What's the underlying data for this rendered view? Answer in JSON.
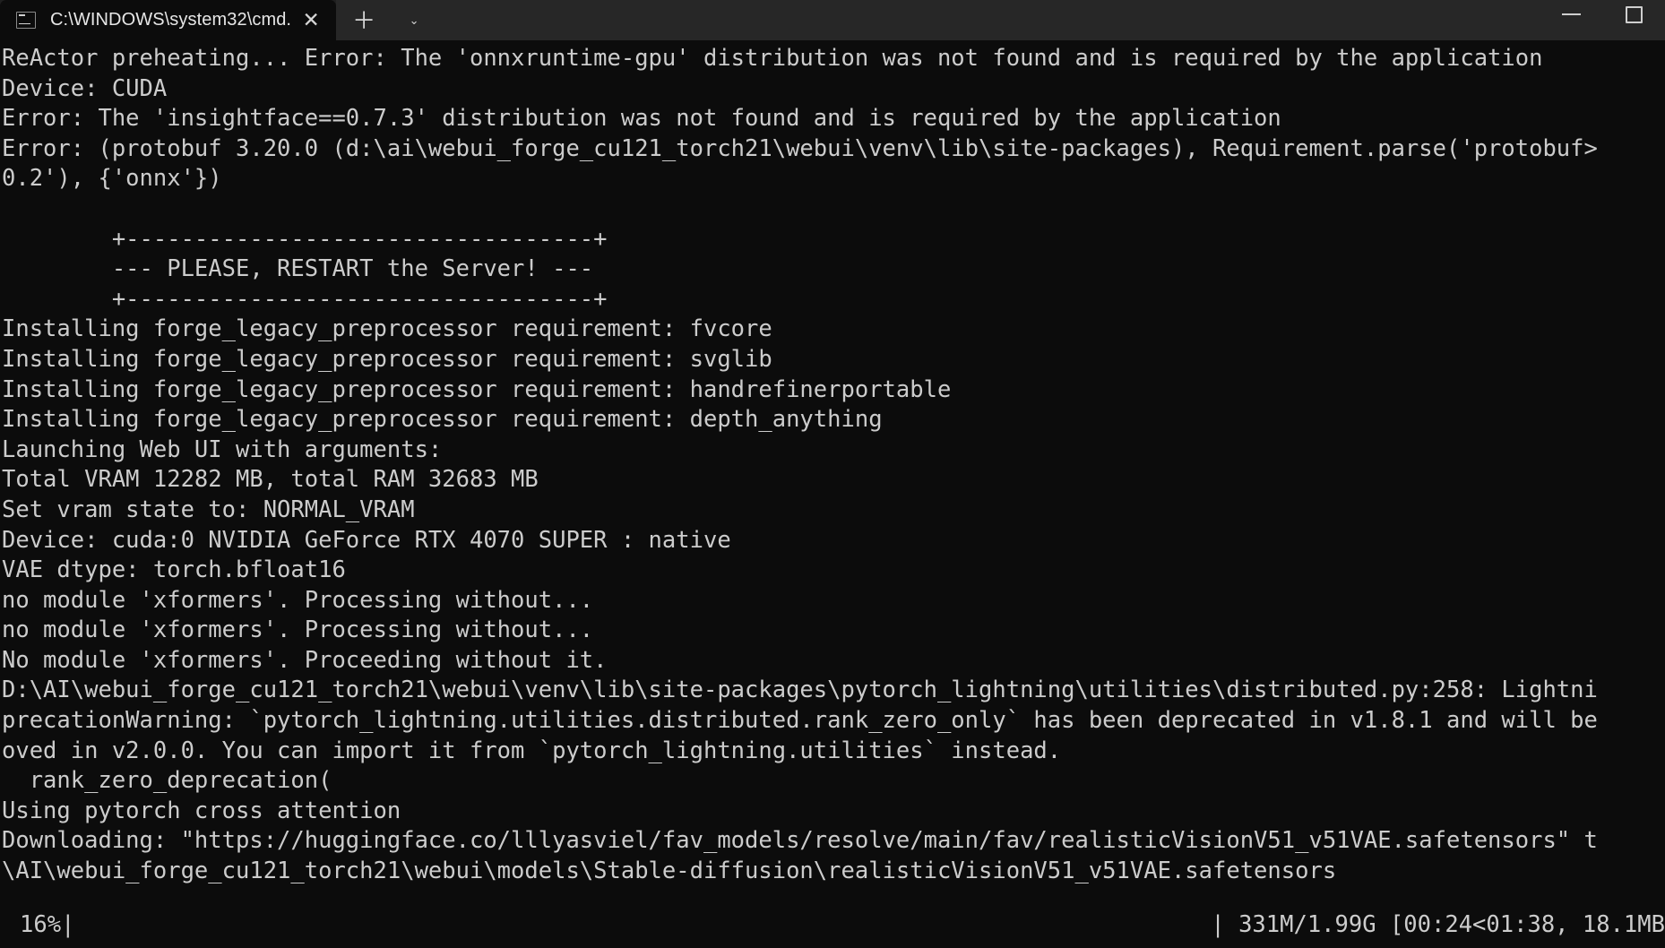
{
  "window": {
    "tab_title": "C:\\WINDOWS\\system32\\cmd.",
    "tab_icon": "cmd-console-icon",
    "close_glyph": "✕",
    "newtab_glyph": "＋",
    "tabmenu_glyph": "⌄",
    "minimize_label": "minimize",
    "maximize_label": "maximize",
    "colors": {
      "chrome_bg": "#272727",
      "tab_bg": "#0c0c0c",
      "terminal_bg": "#0c0c0c",
      "terminal_fg": "#cccccc",
      "progress_fill": "#a6a6a6"
    }
  },
  "console": {
    "lines": [
      "ReActor preheating... Error: The 'onnxruntime-gpu' distribution was not found and is required by the application",
      "Device: CUDA",
      "Error: The 'insightface==0.7.3' distribution was not found and is required by the application",
      "Error: (protobuf 3.20.0 (d:\\ai\\webui_forge_cu121_torch21\\webui\\venv\\lib\\site-packages), Requirement.parse('protobuf>",
      "0.2'), {'onnx'})",
      "",
      "        +----------------------------------+",
      "        --- PLEASE, RESTART the Server! ---",
      "        +----------------------------------+",
      "Installing forge_legacy_preprocessor requirement: fvcore",
      "Installing forge_legacy_preprocessor requirement: svglib",
      "Installing forge_legacy_preprocessor requirement: handrefinerportable",
      "Installing forge_legacy_preprocessor requirement: depth_anything",
      "Launching Web UI with arguments:",
      "Total VRAM 12282 MB, total RAM 32683 MB",
      "Set vram state to: NORMAL_VRAM",
      "Device: cuda:0 NVIDIA GeForce RTX 4070 SUPER : native",
      "VAE dtype: torch.bfloat16",
      "no module 'xformers'. Processing without...",
      "no module 'xformers'. Processing without...",
      "No module 'xformers'. Proceeding without it.",
      "D:\\AI\\webui_forge_cu121_torch21\\webui\\venv\\lib\\site-packages\\pytorch_lightning\\utilities\\distributed.py:258: Lightni",
      "precationWarning: `pytorch_lightning.utilities.distributed.rank_zero_only` has been deprecated in v1.8.1 and will be",
      "oved in v2.0.0. You can import it from `pytorch_lightning.utilities` instead.",
      "  rank_zero_deprecation(",
      "Using pytorch cross attention",
      "Downloading: \"https://huggingface.co/lllyasviel/fav_models/resolve/main/fav/realisticVisionV51_v51VAE.safetensors\" t",
      "\\AI\\webui_forge_cu121_torch21\\webui\\models\\Stable-diffusion\\realisticVisionV51_v51VAE.safetensors"
    ]
  },
  "progress": {
    "percent_label": "16%",
    "percent_value": 16,
    "bar_separator": "|",
    "downloaded": "331M",
    "total": "1.99G",
    "elapsed": "00:24",
    "remaining": "01:38",
    "rate": "18.1MB",
    "right_text": "| 331M/1.99G [00:24<01:38, 18.1MB"
  }
}
